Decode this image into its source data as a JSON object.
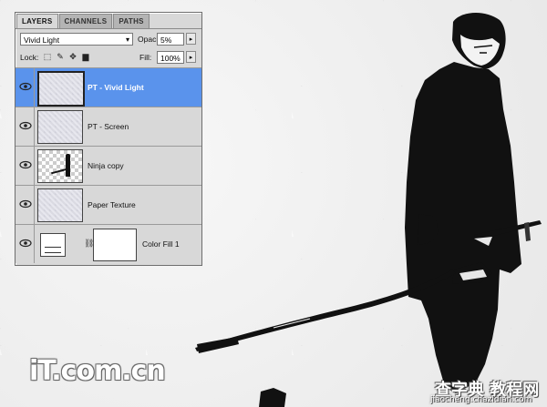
{
  "panel": {
    "tabs": [
      {
        "label": "LAYERS"
      },
      {
        "label": "CHANNELS"
      },
      {
        "label": "PATHS"
      }
    ],
    "blend_mode": "Vivid Light",
    "opacity_label": "Opacity:",
    "opacity_value": "5%",
    "lock_label": "Lock:",
    "fill_label": "Fill:",
    "fill_value": "100%",
    "layers": [
      {
        "name": "PT - Vivid Light",
        "selected": true,
        "visible": true
      },
      {
        "name": "PT - Screen",
        "selected": false,
        "visible": true
      },
      {
        "name": "Ninja copy",
        "selected": false,
        "visible": true
      },
      {
        "name": "Paper Texture",
        "selected": false,
        "visible": true
      },
      {
        "name": "Color Fill 1",
        "selected": false,
        "visible": true
      }
    ]
  },
  "watermarks": {
    "site_logo": "iT.com.cn",
    "cn_brand": "查字典 教程网",
    "url": "jiaocheng.chazidian.com"
  },
  "colors": {
    "selection": "#5a93ec",
    "panel": "#d8d8d8",
    "figure": "#111111"
  }
}
